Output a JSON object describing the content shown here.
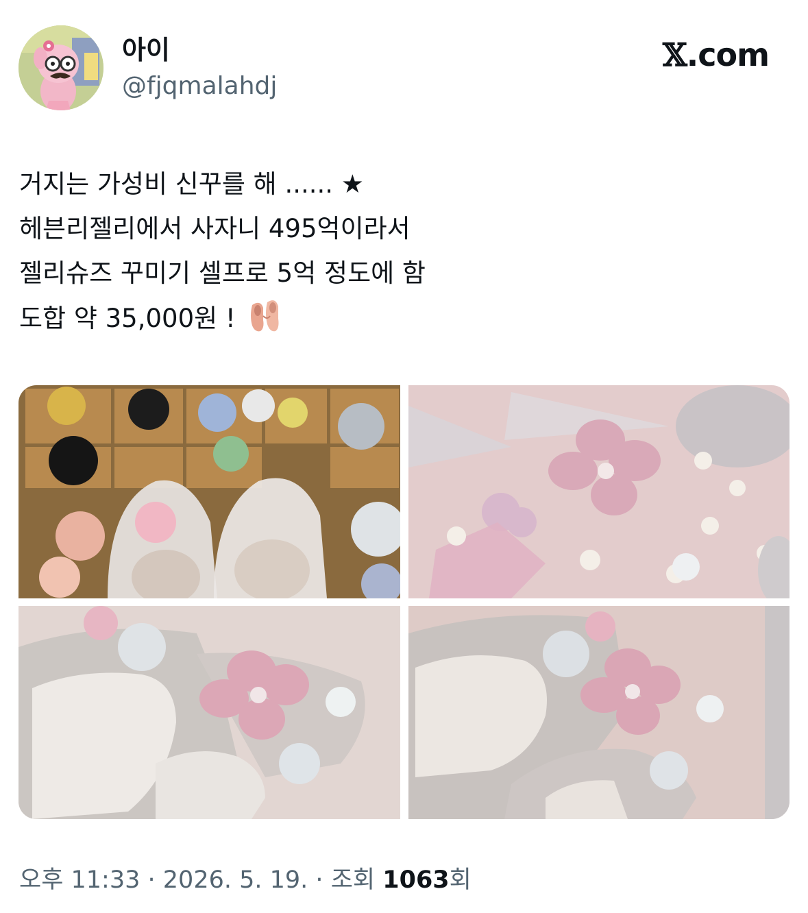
{
  "author": {
    "display_name": "아이",
    "handle": "@fjqmalahdj",
    "avatar_icon": "avatar-cartoon-pink-character"
  },
  "brand": {
    "x_glyph": "𝕏",
    "domain": ".com"
  },
  "tweet": {
    "lines": [
      "거지는 가성비 신꾸를 해 ...... ★",
      "헤븐리젤리에서 사자니 495억이라서",
      "젤리슈즈 꾸미기 셀프로 5억 정도에 함",
      "도합 약 35,000원 !"
    ],
    "emoji_icon": "ballet-shoes-icon"
  },
  "media": {
    "count": 4,
    "images": [
      "photo-clear-jelly-shoes-on-bead-display",
      "photo-pink-flower-charms-and-beads",
      "photo-decorated-jelly-shoes-closeup-1",
      "photo-decorated-jelly-shoes-closeup-2"
    ]
  },
  "meta": {
    "time": "오후 11:33",
    "separator": " · ",
    "date": "2026. 5. 19.",
    "views_label": "조회",
    "views_count": "1063",
    "views_suffix": "회"
  },
  "colors": {
    "text_primary": "#0f1419",
    "text_secondary": "#536471",
    "background": "#ffffff"
  }
}
